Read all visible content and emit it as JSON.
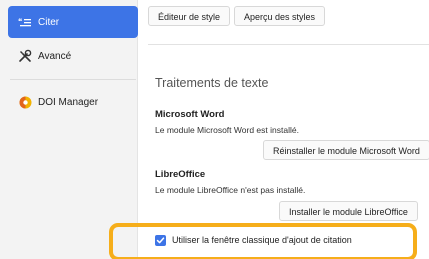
{
  "sidebar": {
    "items": [
      {
        "label": "Citer",
        "icon": "cite-icon",
        "active": true
      },
      {
        "label": "Avancé",
        "icon": "tools-icon",
        "active": false
      },
      {
        "label": "DOI Manager",
        "icon": "doi-manager-icon",
        "active": false
      }
    ]
  },
  "top_buttons": {
    "style_editor": "Éditeur de style",
    "style_preview": "Aperçu des styles"
  },
  "word_processors": {
    "title": "Traitements de texte",
    "word": {
      "name": "Microsoft Word",
      "status": "Le module Microsoft Word est installé.",
      "button": "Réinstaller le module Microsoft Word"
    },
    "libreoffice": {
      "name": "LibreOffice",
      "status": "Le module LibreOffice n'est pas installé.",
      "button": "Installer le module LibreOffice"
    },
    "classic_dialog": {
      "label": "Utiliser la fenêtre classique d'ajout de citation",
      "checked": true
    }
  },
  "colors": {
    "accent": "#3d74e6",
    "highlight": "#f6ae1a"
  }
}
